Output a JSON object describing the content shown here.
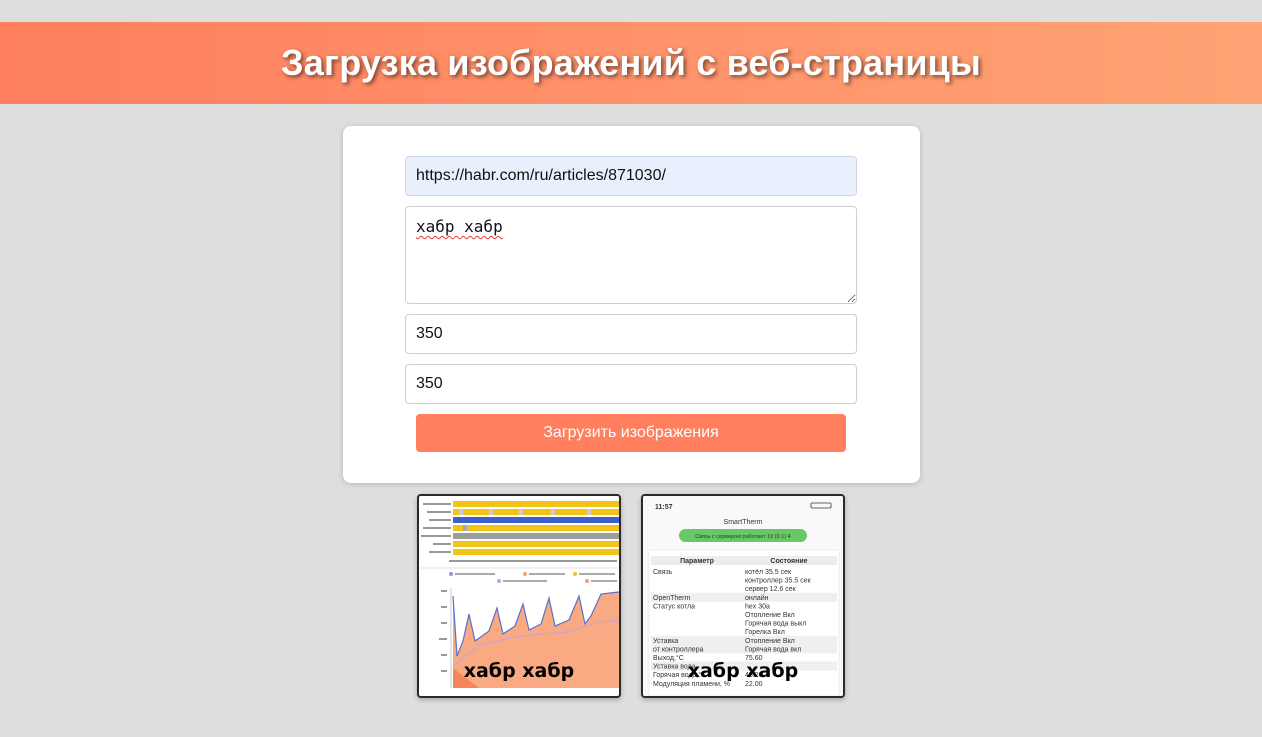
{
  "header": {
    "title": "Загрузка изображений с веб-страницы"
  },
  "form": {
    "url_value": "https://habr.com/ru/articles/871030/",
    "watermark_text": "хабр хабр",
    "width_value": "350",
    "height_value": "350",
    "submit_label": "Загрузить изображения"
  },
  "gallery": {
    "images": [
      {
        "watermark": "хабр хабр"
      },
      {
        "watermark": "хабр хабр",
        "status_time": "11:57",
        "app_title": "SmartTherm",
        "status_badge": "Связь с сервером работает 10 (0 1) 4",
        "table_headers": [
          "Параметр",
          "Состояние"
        ],
        "table_rows": [
          [
            "Связь",
            "котёл 35.5 сек"
          ],
          [
            "",
            "контроллер 35.5 сек"
          ],
          [
            "",
            "сервер 12.6 сек"
          ],
          [
            "OpenTherm",
            "онлайн"
          ],
          [
            "Статус котла",
            "hex 30a"
          ],
          [
            "",
            "Отопление Вкл"
          ],
          [
            "",
            "Горячая вода выкл"
          ],
          [
            "",
            "Горелка Вкл"
          ],
          [
            "Уставка",
            "Отопление Вкл"
          ],
          [
            "от контроллера",
            "Горячая вода вкл"
          ],
          [
            "Выход,°С",
            "75.60"
          ],
          [
            "Уставка вода",
            ""
          ],
          [
            "Горячая вода,°С",
            "45.20"
          ],
          [
            "Модуляция пламени, %",
            "22.00"
          ]
        ]
      }
    ]
  },
  "colors": {
    "accent": "#ff7f5e",
    "banner_end": "#ffa474",
    "page_bg": "#dedede",
    "url_bg": "#e8f0fe"
  }
}
